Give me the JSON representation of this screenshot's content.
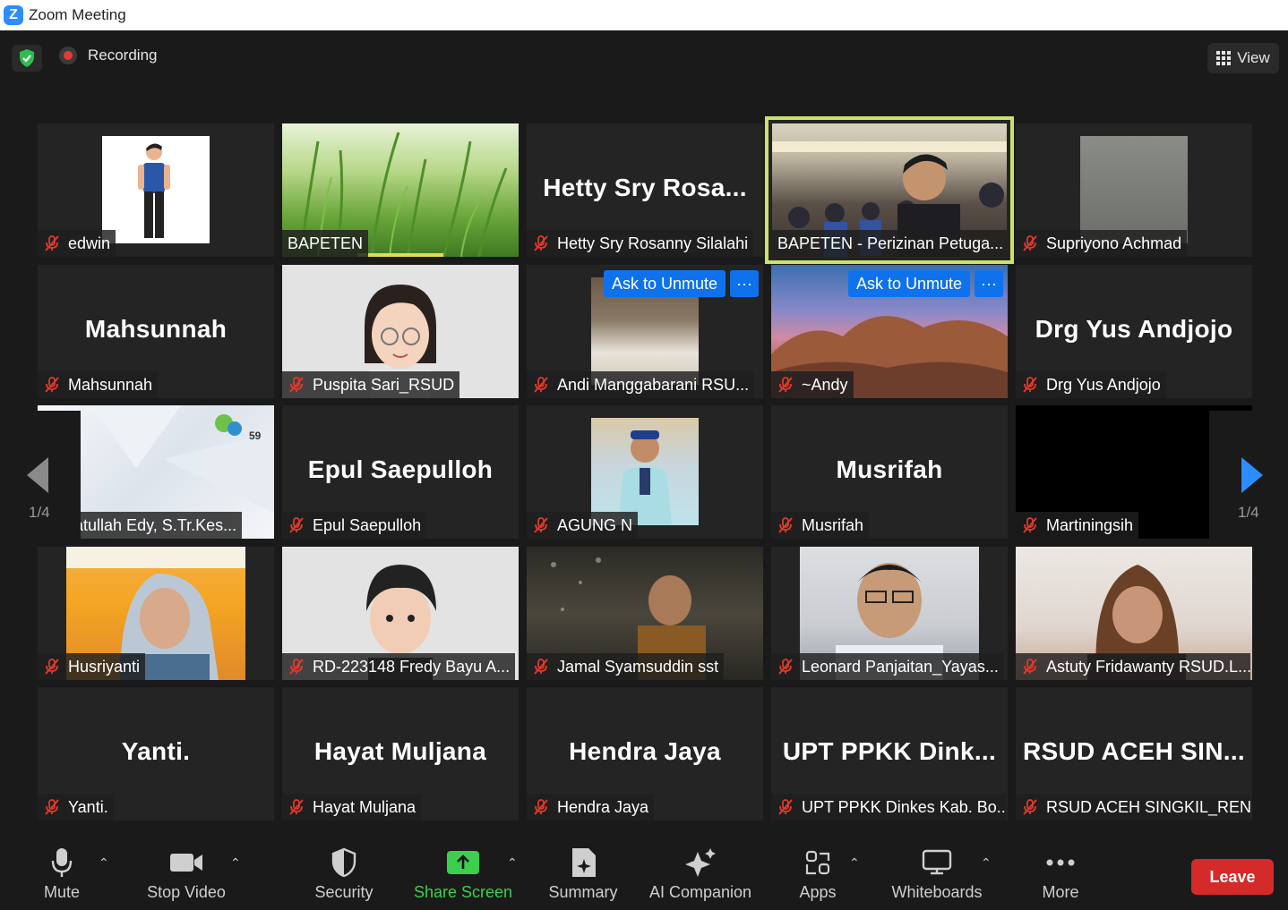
{
  "window": {
    "title": "Zoom Meeting"
  },
  "topbar": {
    "recording_label": "Recording",
    "view_label": "View"
  },
  "pager": {
    "left": "1/4",
    "right": "1/4"
  },
  "tiles": [
    {
      "label": "edwin",
      "big": ""
    },
    {
      "label": "BAPETEN",
      "big": ""
    },
    {
      "label": "Hetty Sry Rosanny Silalahi",
      "big": "Hetty Sry Rosa..."
    },
    {
      "label": "BAPETEN - Perizinan Petuga...",
      "big": ""
    },
    {
      "label": "Supriyono Achmad",
      "big": ""
    },
    {
      "label": "Mahsunnah",
      "big": "Mahsunnah"
    },
    {
      "label": "Puspita Sari_RSUD",
      "big": ""
    },
    {
      "label": "Andi Manggabarani RSU...",
      "big": ""
    },
    {
      "label": "~Andy",
      "big": ""
    },
    {
      "label": "Drg Yus  Andjojo",
      "big": "Drg Yus  Andjojo"
    },
    {
      "label": "ahmatullah Edy, S.Tr.Kes...",
      "big": ""
    },
    {
      "label": "Epul Saepulloh",
      "big": "Epul Saepulloh"
    },
    {
      "label": "AGUNG N",
      "big": ""
    },
    {
      "label": "Musrifah",
      "big": "Musrifah"
    },
    {
      "label": "Martiningsih",
      "big": ""
    },
    {
      "label": "Husriyanti",
      "big": ""
    },
    {
      "label": "RD-223148 Fredy Bayu A...",
      "big": ""
    },
    {
      "label": "Jamal Syamsuddin sst",
      "big": ""
    },
    {
      "label": "Leonard Panjaitan_Yayas...",
      "big": ""
    },
    {
      "label": "Astuty Fridawanty RSUD.L...",
      "big": ""
    },
    {
      "label": "Yanti.",
      "big": "Yanti."
    },
    {
      "label": "Hayat Muljana",
      "big": "Hayat Muljana"
    },
    {
      "label": "Hendra Jaya",
      "big": "Hendra Jaya"
    },
    {
      "label": "UPT PPKK Dinkes Kab. Bo...",
      "big": "UPT PPKK Dink..."
    },
    {
      "label": "RSUD ACEH SINGKIL_REN...",
      "big": "RSUD ACEH SIN..."
    }
  ],
  "ask_to_unmute": "Ask to Unmute",
  "more_glyph": "···",
  "toolbar": {
    "mute": "Mute",
    "stop_video": "Stop Video",
    "security": "Security",
    "share_screen": "Share Screen",
    "summary": "Summary",
    "ai_companion": "AI Companion",
    "apps": "Apps",
    "whiteboards": "Whiteboards",
    "more": "More",
    "leave": "Leave"
  },
  "colors": {
    "accent_blue": "#0e72ed",
    "leave_red": "#d42a2a",
    "share_green": "#3ccf4e",
    "active_speaker": "#c9e26a",
    "muted_red": "#e0392b"
  }
}
